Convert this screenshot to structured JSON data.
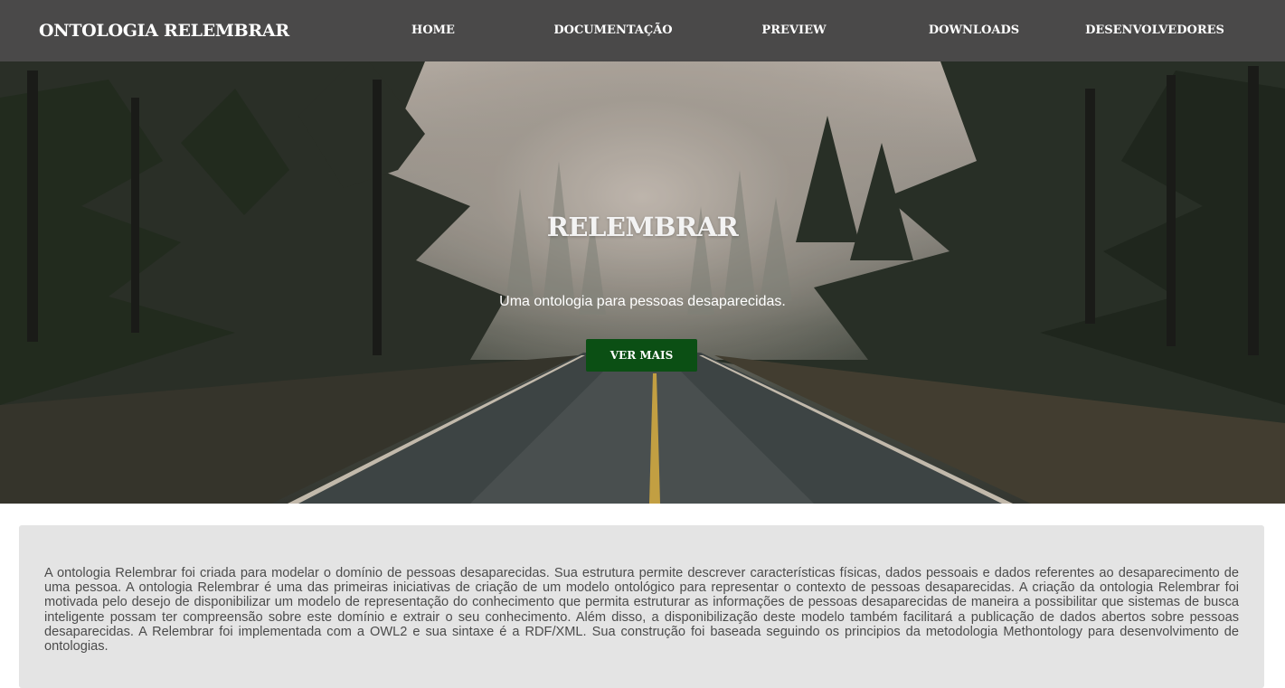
{
  "navbar": {
    "brand": "ONTOLOGIA RELEMBRAR",
    "links": [
      "HOME",
      "DOCUMENTAÇÃO",
      "PREVIEW",
      "DOWNLOADS",
      "DESENVOLVEDORES"
    ]
  },
  "hero": {
    "title": "RELEMBRAR",
    "subtitle": "Uma ontologia para pessoas desaparecidas.",
    "button_label": "VER MAIS"
  },
  "about": {
    "text": "A ontologia Relembrar foi criada para modelar o domínio de pessoas desaparecidas. Sua estrutura permite descrever características físicas, dados pessoais e dados referentes ao desaparecimento de uma pessoa. A ontologia Relembrar é uma das primeiras iniciativas de criação de um modelo ontológico para representar o contexto de pessoas desaparecidas. A criação da ontologia Relembrar foi motivada pelo desejo de disponibilizar um modelo de representação do conhecimento que permita estruturar as informações de pessoas desaparecidas de maneira a possibilitar que sistemas de busca inteligente possam ter compreensão sobre este domínio e extrair o seu conhecimento. Além disso, a disponibilização deste modelo também facilitará a publicação de dados abertos sobre pessoas desaparecidas. A Relembrar foi implementada com a OWL2 e sua sintaxe é a RDF/XML. Sua construção foi baseada seguindo os principios da metodologia Methontology para desenvolvimento de ontologias."
  },
  "colors": {
    "navbar_bg": "#4a4949",
    "button_bg": "#0b4f14",
    "card_bg": "#e4e4e4"
  }
}
